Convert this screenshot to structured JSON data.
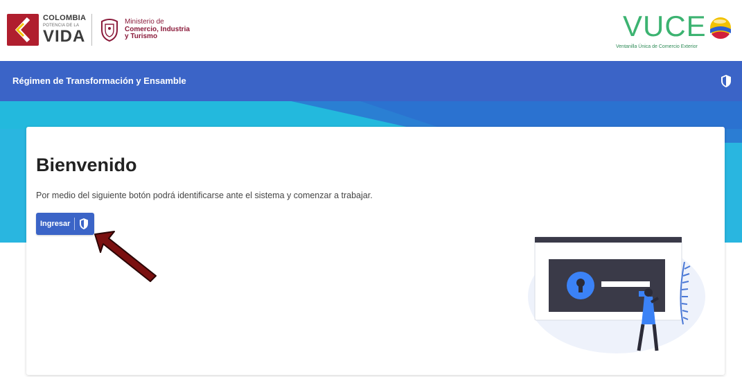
{
  "header": {
    "colombia_logo": {
      "line1": "COLOMBIA",
      "line2": "POTENCIA DE LA",
      "line3": "VIDA"
    },
    "ministry": {
      "line1": "Ministerio de",
      "line2": "Comercio, Industria",
      "line3": "y Turismo"
    },
    "vuce": {
      "title": "VUCE",
      "subtitle": "Ventanilla Única de Comercio Exterior"
    }
  },
  "topbar": {
    "title": "Régimen de Transformación y Ensamble",
    "icon": "shield-icon"
  },
  "card": {
    "title": "Bienvenido",
    "description": "Por medio del siguiente botón podrá identificarse ante el sistema y comenzar a trabajar.",
    "login_button": {
      "label": "Ingresar",
      "icon": "shield-icon"
    }
  },
  "colors": {
    "primary_blue": "#3b64c7",
    "banner_cyan": "#2bb3d8",
    "ministry_red": "#8a1a3a",
    "vuce_green": "#3cb371",
    "arrow_red": "#7a1010"
  }
}
